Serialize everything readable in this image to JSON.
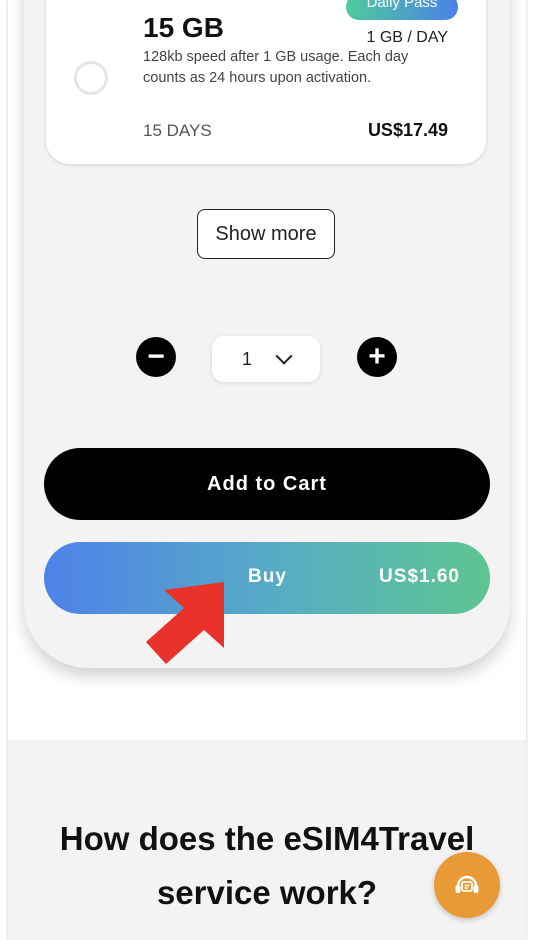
{
  "plan": {
    "badge": "Daily Pass",
    "data_amount": "15 GB",
    "rate": "1 GB / DAY",
    "description": "128kb speed after 1 GB usage. Each day counts as 24 hours upon activation.",
    "duration": "15 DAYS",
    "price": "US$17.49"
  },
  "show_more_label": "Show more",
  "quantity": {
    "minus_symbol": "−",
    "plus_symbol": "+",
    "value": "1"
  },
  "add_to_cart_label": "Add to Cart",
  "buy": {
    "label": "Buy",
    "price": "US$1.60"
  },
  "how_it_works_title": "How does the eSIM4Travel service work?",
  "colors": {
    "buy_gradient_start": "#4f82e9",
    "buy_gradient_end": "#5ec48f",
    "support_button": "#e89a37",
    "arrow": "#e8322a"
  },
  "icons": {
    "support": "headset-chat-icon",
    "annotation_arrow": "red-arrow-icon"
  }
}
